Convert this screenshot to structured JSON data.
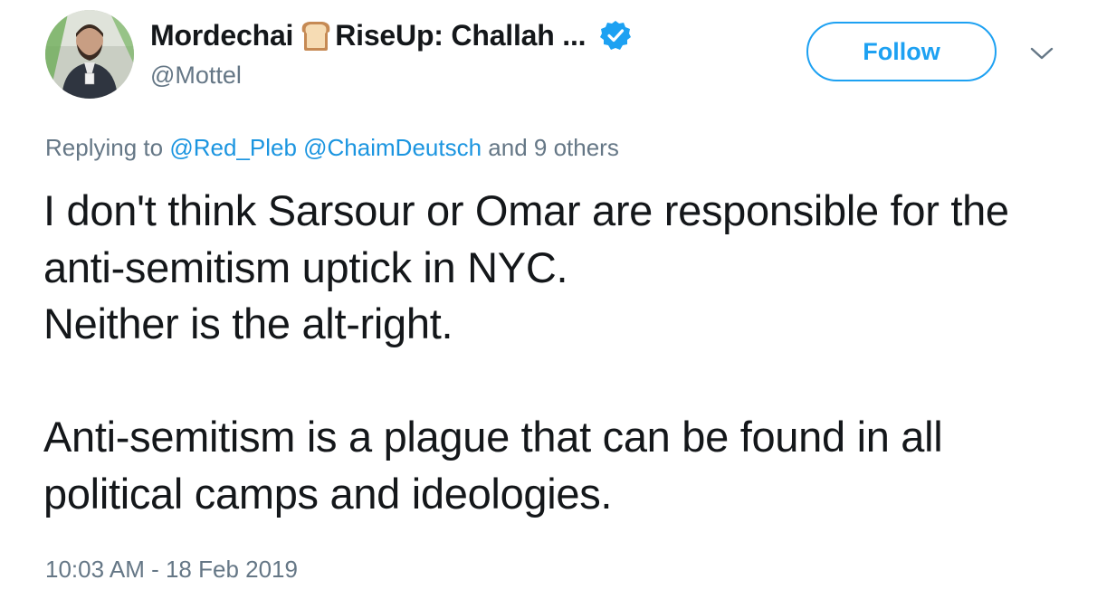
{
  "author": {
    "display_name_first": "Mordechai",
    "display_name_rest": "RiseUp: Challah ...",
    "handle": "@Mottel",
    "name_emoji": "bread-emoji",
    "verified_icon": "verified-badge-icon",
    "verified_color": "#1da1f2"
  },
  "actions": {
    "follow_label": "Follow",
    "more_icon": "chevron-down-icon"
  },
  "reply_context": {
    "prefix": "Replying to",
    "mentions": [
      "@Red_Pleb",
      "@ChaimDeutsch"
    ],
    "suffix": "and 9 others"
  },
  "tweet": {
    "paragraphs": [
      "I don't think Sarsour or Omar are responsible for the anti-semitism uptick in NYC.\nNeither is the alt-right.",
      "Anti-semitism is a plague that can be found in all political camps and ideologies."
    ],
    "timestamp": "10:03 AM - 18 Feb 2019"
  },
  "colors": {
    "text": "#14171a",
    "secondary": "#657786",
    "accent": "#1da1f2",
    "link": "#1b95e0"
  }
}
